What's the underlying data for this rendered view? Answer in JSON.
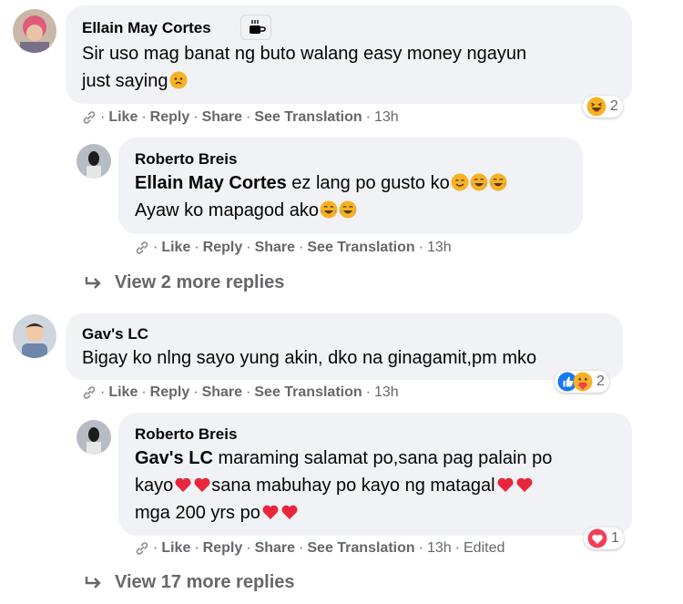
{
  "comments": [
    {
      "author": "Ellain May Cortes",
      "text_line1": "Sir uso mag banat ng buto walang easy money ngayun",
      "text_line2": "just saying",
      "actions": {
        "like": "Like",
        "reply": "Reply",
        "share": "Share",
        "translate": "See Translation",
        "time": "13h"
      },
      "reaction_count": "2"
    },
    {
      "author": "Roberto Breis",
      "mention": "Ellain May Cortes",
      "text_line1": " ez lang po gusto ko",
      "text_line2": "Ayaw ko mapagod ako",
      "actions": {
        "like": "Like",
        "reply": "Reply",
        "share": "Share",
        "translate": "See Translation",
        "time": "13h"
      }
    },
    {
      "author": "Gav's LC",
      "text_line1": "Bigay ko nlng sayo yung akin, dko na ginagamit,pm mko",
      "actions": {
        "like": "Like",
        "reply": "Reply",
        "share": "Share",
        "translate": "See Translation",
        "time": "13h"
      },
      "reaction_count": "2"
    },
    {
      "author": "Roberto Breis",
      "mention": "Gav's LC",
      "text_line1": " maraming salamat po,sana pag palain po",
      "text_line2a": "kayo",
      "text_line2b": "sana mabuhay po kayo ng matagal",
      "text_line3": "mga 200 yrs po",
      "actions": {
        "like": "Like",
        "reply": "Reply",
        "share": "Share",
        "translate": "See Translation",
        "time": "13h",
        "edited": "Edited"
      },
      "reaction_count": "1"
    }
  ],
  "view_more_1": "View 2 more replies",
  "view_more_2": "View 17 more replies",
  "colors": {
    "bubble": "#f0f2f5",
    "meta": "#65676b",
    "like_blue": "#1877f2",
    "heart_red": "#f33e58",
    "emoji_yellow": "#f7b125"
  }
}
